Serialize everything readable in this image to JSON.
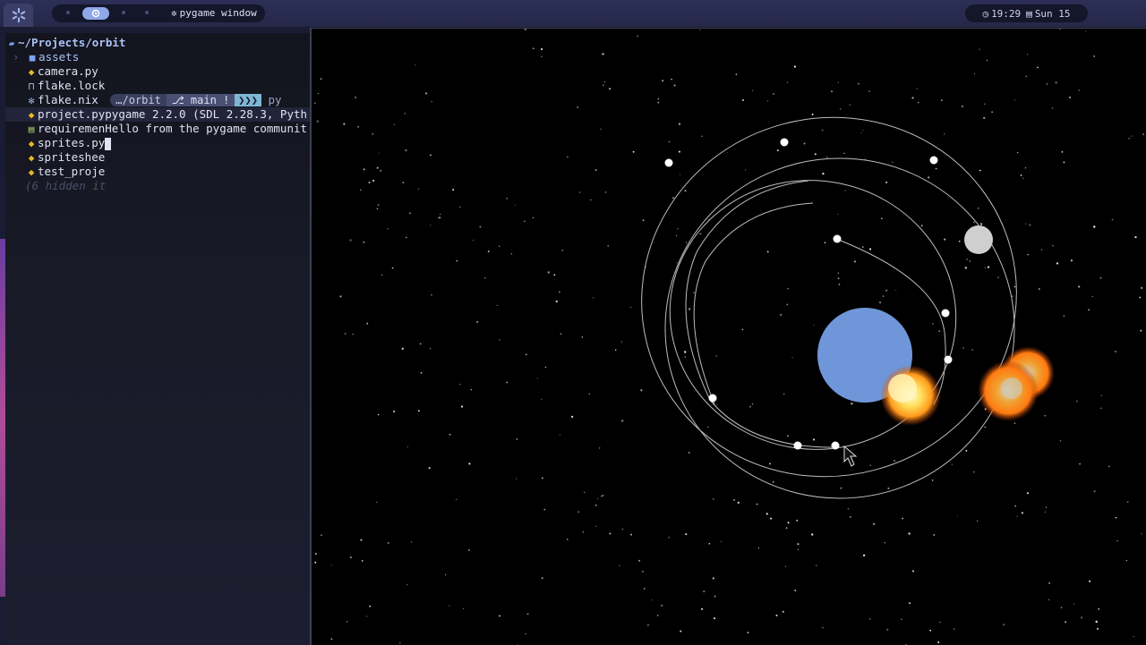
{
  "topbar": {
    "window_title": "pygame window",
    "time": "19:29",
    "date": "Sun 15",
    "icons": [
      "nixos-snowflake-icon",
      "workspace-active-icon",
      "gear-icon",
      "clock-icon",
      "calendar-icon"
    ]
  },
  "terminal": {
    "cwd": "~/Projects/orbit",
    "entries": [
      {
        "name": "assets",
        "icon": "folder-icon"
      },
      {
        "name": "camera.py",
        "icon": "python-icon"
      },
      {
        "name": "flake.lock",
        "icon": "lock-icon"
      },
      {
        "name": "flake.nix",
        "icon": "nix-icon"
      },
      {
        "name": "project.py",
        "icon": "python-icon"
      },
      {
        "name": "requiremen",
        "icon": "text-file-icon"
      },
      {
        "name": "sprites.py",
        "icon": "python-icon"
      },
      {
        "name": "spriteshee",
        "icon": "python-icon"
      },
      {
        "name": "test_proje",
        "icon": "python-icon"
      }
    ],
    "hidden": "(6 hidden it",
    "prompt_dir": "…/orbit",
    "prompt_branch": "main !",
    "prompt_cmd": "py",
    "output_1": "pygame 2.2.0 (SDL 2.28.3, Pyth",
    "output_2": "Hello from the pygame communit"
  },
  "colors": {
    "planet": "#6f96d8",
    "moon": "#cfcfcf",
    "explosion": "#ffb020",
    "accent": "#8fa8e8"
  }
}
